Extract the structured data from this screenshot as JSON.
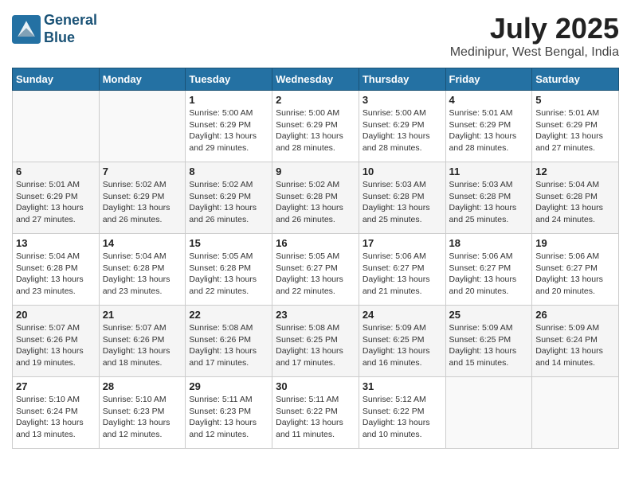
{
  "header": {
    "logo_line1": "General",
    "logo_line2": "Blue",
    "month": "July 2025",
    "location": "Medinipur, West Bengal, India"
  },
  "days_of_week": [
    "Sunday",
    "Monday",
    "Tuesday",
    "Wednesday",
    "Thursday",
    "Friday",
    "Saturday"
  ],
  "weeks": [
    [
      {
        "day": "",
        "info": ""
      },
      {
        "day": "",
        "info": ""
      },
      {
        "day": "1",
        "info": "Sunrise: 5:00 AM\nSunset: 6:29 PM\nDaylight: 13 hours\nand 29 minutes."
      },
      {
        "day": "2",
        "info": "Sunrise: 5:00 AM\nSunset: 6:29 PM\nDaylight: 13 hours\nand 28 minutes."
      },
      {
        "day": "3",
        "info": "Sunrise: 5:00 AM\nSunset: 6:29 PM\nDaylight: 13 hours\nand 28 minutes."
      },
      {
        "day": "4",
        "info": "Sunrise: 5:01 AM\nSunset: 6:29 PM\nDaylight: 13 hours\nand 28 minutes."
      },
      {
        "day": "5",
        "info": "Sunrise: 5:01 AM\nSunset: 6:29 PM\nDaylight: 13 hours\nand 27 minutes."
      }
    ],
    [
      {
        "day": "6",
        "info": "Sunrise: 5:01 AM\nSunset: 6:29 PM\nDaylight: 13 hours\nand 27 minutes."
      },
      {
        "day": "7",
        "info": "Sunrise: 5:02 AM\nSunset: 6:29 PM\nDaylight: 13 hours\nand 26 minutes."
      },
      {
        "day": "8",
        "info": "Sunrise: 5:02 AM\nSunset: 6:29 PM\nDaylight: 13 hours\nand 26 minutes."
      },
      {
        "day": "9",
        "info": "Sunrise: 5:02 AM\nSunset: 6:28 PM\nDaylight: 13 hours\nand 26 minutes."
      },
      {
        "day": "10",
        "info": "Sunrise: 5:03 AM\nSunset: 6:28 PM\nDaylight: 13 hours\nand 25 minutes."
      },
      {
        "day": "11",
        "info": "Sunrise: 5:03 AM\nSunset: 6:28 PM\nDaylight: 13 hours\nand 25 minutes."
      },
      {
        "day": "12",
        "info": "Sunrise: 5:04 AM\nSunset: 6:28 PM\nDaylight: 13 hours\nand 24 minutes."
      }
    ],
    [
      {
        "day": "13",
        "info": "Sunrise: 5:04 AM\nSunset: 6:28 PM\nDaylight: 13 hours\nand 23 minutes."
      },
      {
        "day": "14",
        "info": "Sunrise: 5:04 AM\nSunset: 6:28 PM\nDaylight: 13 hours\nand 23 minutes."
      },
      {
        "day": "15",
        "info": "Sunrise: 5:05 AM\nSunset: 6:28 PM\nDaylight: 13 hours\nand 22 minutes."
      },
      {
        "day": "16",
        "info": "Sunrise: 5:05 AM\nSunset: 6:27 PM\nDaylight: 13 hours\nand 22 minutes."
      },
      {
        "day": "17",
        "info": "Sunrise: 5:06 AM\nSunset: 6:27 PM\nDaylight: 13 hours\nand 21 minutes."
      },
      {
        "day": "18",
        "info": "Sunrise: 5:06 AM\nSunset: 6:27 PM\nDaylight: 13 hours\nand 20 minutes."
      },
      {
        "day": "19",
        "info": "Sunrise: 5:06 AM\nSunset: 6:27 PM\nDaylight: 13 hours\nand 20 minutes."
      }
    ],
    [
      {
        "day": "20",
        "info": "Sunrise: 5:07 AM\nSunset: 6:26 PM\nDaylight: 13 hours\nand 19 minutes."
      },
      {
        "day": "21",
        "info": "Sunrise: 5:07 AM\nSunset: 6:26 PM\nDaylight: 13 hours\nand 18 minutes."
      },
      {
        "day": "22",
        "info": "Sunrise: 5:08 AM\nSunset: 6:26 PM\nDaylight: 13 hours\nand 17 minutes."
      },
      {
        "day": "23",
        "info": "Sunrise: 5:08 AM\nSunset: 6:25 PM\nDaylight: 13 hours\nand 17 minutes."
      },
      {
        "day": "24",
        "info": "Sunrise: 5:09 AM\nSunset: 6:25 PM\nDaylight: 13 hours\nand 16 minutes."
      },
      {
        "day": "25",
        "info": "Sunrise: 5:09 AM\nSunset: 6:25 PM\nDaylight: 13 hours\nand 15 minutes."
      },
      {
        "day": "26",
        "info": "Sunrise: 5:09 AM\nSunset: 6:24 PM\nDaylight: 13 hours\nand 14 minutes."
      }
    ],
    [
      {
        "day": "27",
        "info": "Sunrise: 5:10 AM\nSunset: 6:24 PM\nDaylight: 13 hours\nand 13 minutes."
      },
      {
        "day": "28",
        "info": "Sunrise: 5:10 AM\nSunset: 6:23 PM\nDaylight: 13 hours\nand 12 minutes."
      },
      {
        "day": "29",
        "info": "Sunrise: 5:11 AM\nSunset: 6:23 PM\nDaylight: 13 hours\nand 12 minutes."
      },
      {
        "day": "30",
        "info": "Sunrise: 5:11 AM\nSunset: 6:22 PM\nDaylight: 13 hours\nand 11 minutes."
      },
      {
        "day": "31",
        "info": "Sunrise: 5:12 AM\nSunset: 6:22 PM\nDaylight: 13 hours\nand 10 minutes."
      },
      {
        "day": "",
        "info": ""
      },
      {
        "day": "",
        "info": ""
      }
    ]
  ]
}
